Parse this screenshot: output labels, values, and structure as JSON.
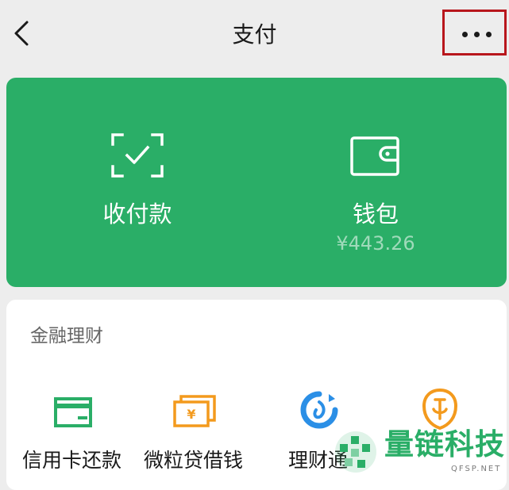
{
  "header": {
    "title": "支付"
  },
  "payment": {
    "receive": {
      "label": "收付款",
      "icon": "scan-frame-check-icon"
    },
    "wallet": {
      "label": "钱包",
      "balance": "¥443.26",
      "icon": "wallet-icon"
    }
  },
  "finance": {
    "title": "金融理财",
    "items": [
      {
        "label": "信用卡还款",
        "icon": "credit-card-icon",
        "color": "#2aae67"
      },
      {
        "label": "微粒贷借钱",
        "icon": "banknote-icon",
        "color": "#f39a1d"
      },
      {
        "label": "理财通",
        "icon": "fund-swirl-icon",
        "color": "#2b8fe6"
      },
      {
        "label": "",
        "icon": "insurance-icon",
        "color": "#f39a1d"
      }
    ]
  },
  "watermark": {
    "text": "量链科技",
    "sub": "QFSP.NET"
  },
  "colors": {
    "green": "#2aae67",
    "highlight": "#b8161c",
    "background": "#ededed"
  }
}
